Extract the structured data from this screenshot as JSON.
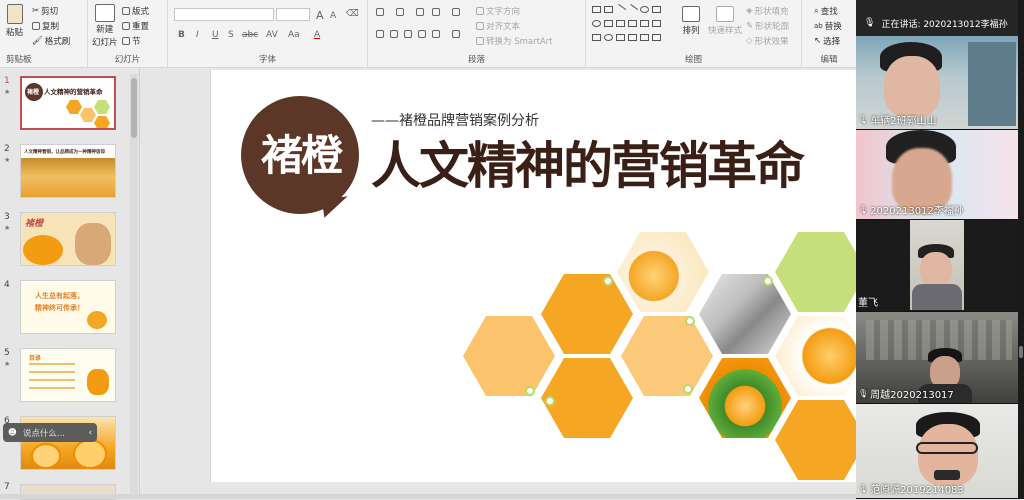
{
  "ribbon": {
    "clipboard": {
      "paste": "粘贴",
      "cut": "剪切",
      "copy": "复制",
      "format_painter": "格式刷",
      "label": "剪贴板"
    },
    "slides": {
      "new_slide_line1": "新建",
      "new_slide_line2": "幻灯片",
      "layout": "版式",
      "reset": "重置",
      "section": "节",
      "label": "幻灯片"
    },
    "font": {
      "label": "字体",
      "bold": "B",
      "italic": "I",
      "underline": "U",
      "strike": "S",
      "shadow": "abc",
      "spacing": "AV",
      "case": "Aa",
      "color": "A",
      "grow": "A",
      "shrink": "A"
    },
    "paragraph": {
      "text_direction": "文字方向",
      "align_text": "对齐文本",
      "convert_smartart": "转换为 SmartArt",
      "label": "段落"
    },
    "drawing": {
      "arrange": "排列",
      "quick_styles": "快速样式",
      "shape_fill": "形状填充",
      "shape_outline": "形状轮廓",
      "shape_effects": "形状效果",
      "label": "绘图"
    },
    "editing": {
      "find": "查找",
      "replace": "替换",
      "select": "选择",
      "label": "编辑"
    }
  },
  "thumbnails": [
    {
      "num": "1",
      "star": "★",
      "text": "人文精神的营销革命",
      "badge": "褚橙"
    },
    {
      "num": "2",
      "star": "★",
      "text": "人文精神营销，让品牌成为一种精神信仰"
    },
    {
      "num": "3",
      "star": "★",
      "text": "褚橙"
    },
    {
      "num": "4",
      "star": "",
      "line1": "人生总有起落，",
      "line2": "精神终可传承！"
    },
    {
      "num": "5",
      "star": "★",
      "text": "目录"
    },
    {
      "num": "6",
      "star": "★",
      "text": ""
    },
    {
      "num": "7",
      "star": "",
      "text": ""
    }
  ],
  "chat_pill": {
    "text": "说点什么..."
  },
  "slide": {
    "brand": "褚橙",
    "subtitle": "——褚橙品牌营销案例分析",
    "title": "人文精神的营销革命"
  },
  "meeting": {
    "speaking": "正在讲话: 2020213012李福孙",
    "participants": [
      {
        "name": "车辆2班郭山山"
      },
      {
        "name": "2020213012李福孙"
      },
      {
        "name": "董飞"
      },
      {
        "name": "周越2020213017"
      },
      {
        "name": "范原源2019214083"
      }
    ]
  },
  "colors": {
    "brand_brown": "#5c3627",
    "orange": "#f5a623",
    "light_orange": "#fbc36b",
    "lime": "#c5e07a",
    "selection": "#c0504d"
  }
}
